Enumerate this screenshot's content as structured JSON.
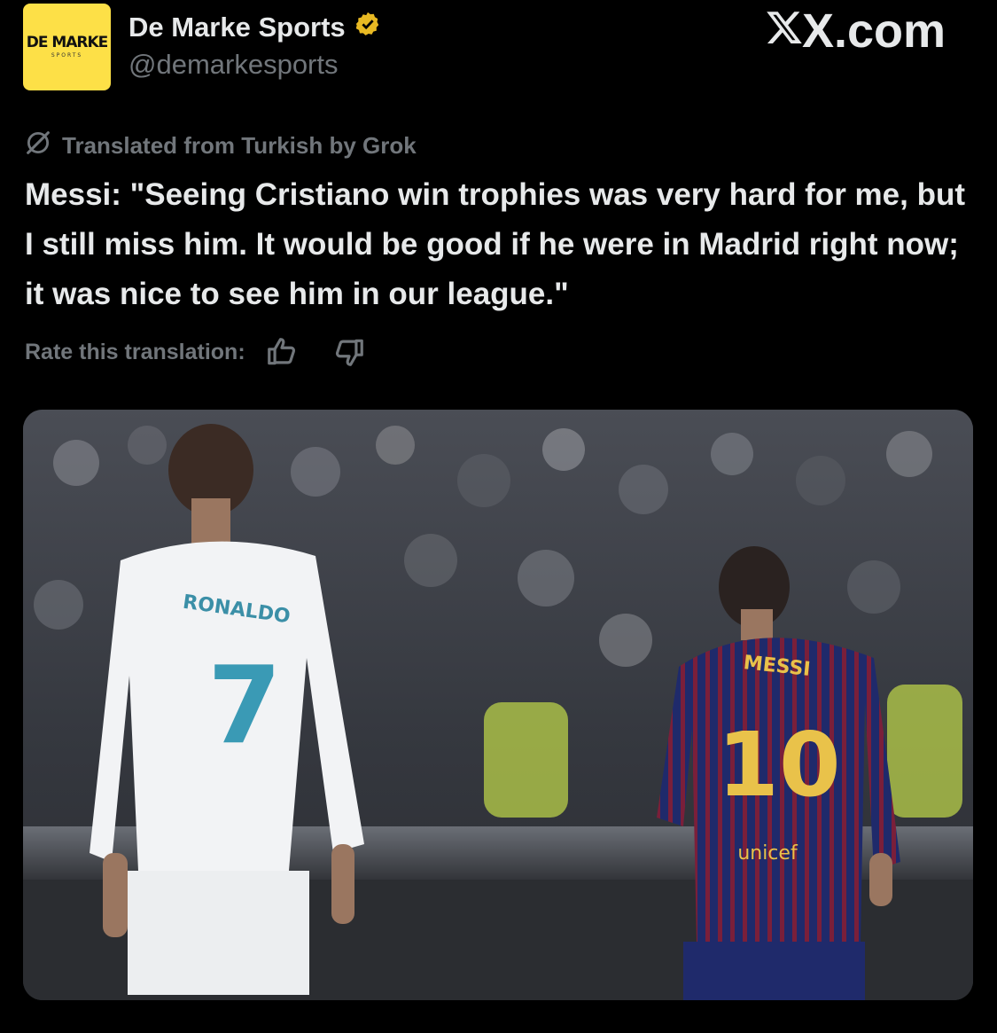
{
  "account": {
    "avatar_logo_text": "DE MARKE",
    "avatar_logo_subtext": "SPORTS",
    "display_name": "De Marke Sports",
    "verified_badge_color": "#e8b923",
    "handle": "@demarkesports"
  },
  "site": {
    "label": "X.com"
  },
  "translation": {
    "notice": "Translated from Turkish by Grok",
    "rate_label": "Rate this translation:"
  },
  "tweet": {
    "text": "Messi: \"Seeing Cristiano win trophies was very hard for me, but I still miss him. It would be good if he were in Madrid right now; it was nice to see him in our league.\""
  },
  "media": {
    "player_left": {
      "name": "RONALDO",
      "number": "7"
    },
    "player_right": {
      "name": "MESSI",
      "number": "10",
      "sponsor": "unicef"
    }
  },
  "icons": [
    "verified-badge-icon",
    "x-logo-icon",
    "grok-icon",
    "thumbs-up-icon",
    "thumbs-down-icon"
  ],
  "colors": {
    "background": "#000000",
    "text": "#e7e9ea",
    "muted": "#71767b",
    "avatar_bg": "#fde047"
  }
}
